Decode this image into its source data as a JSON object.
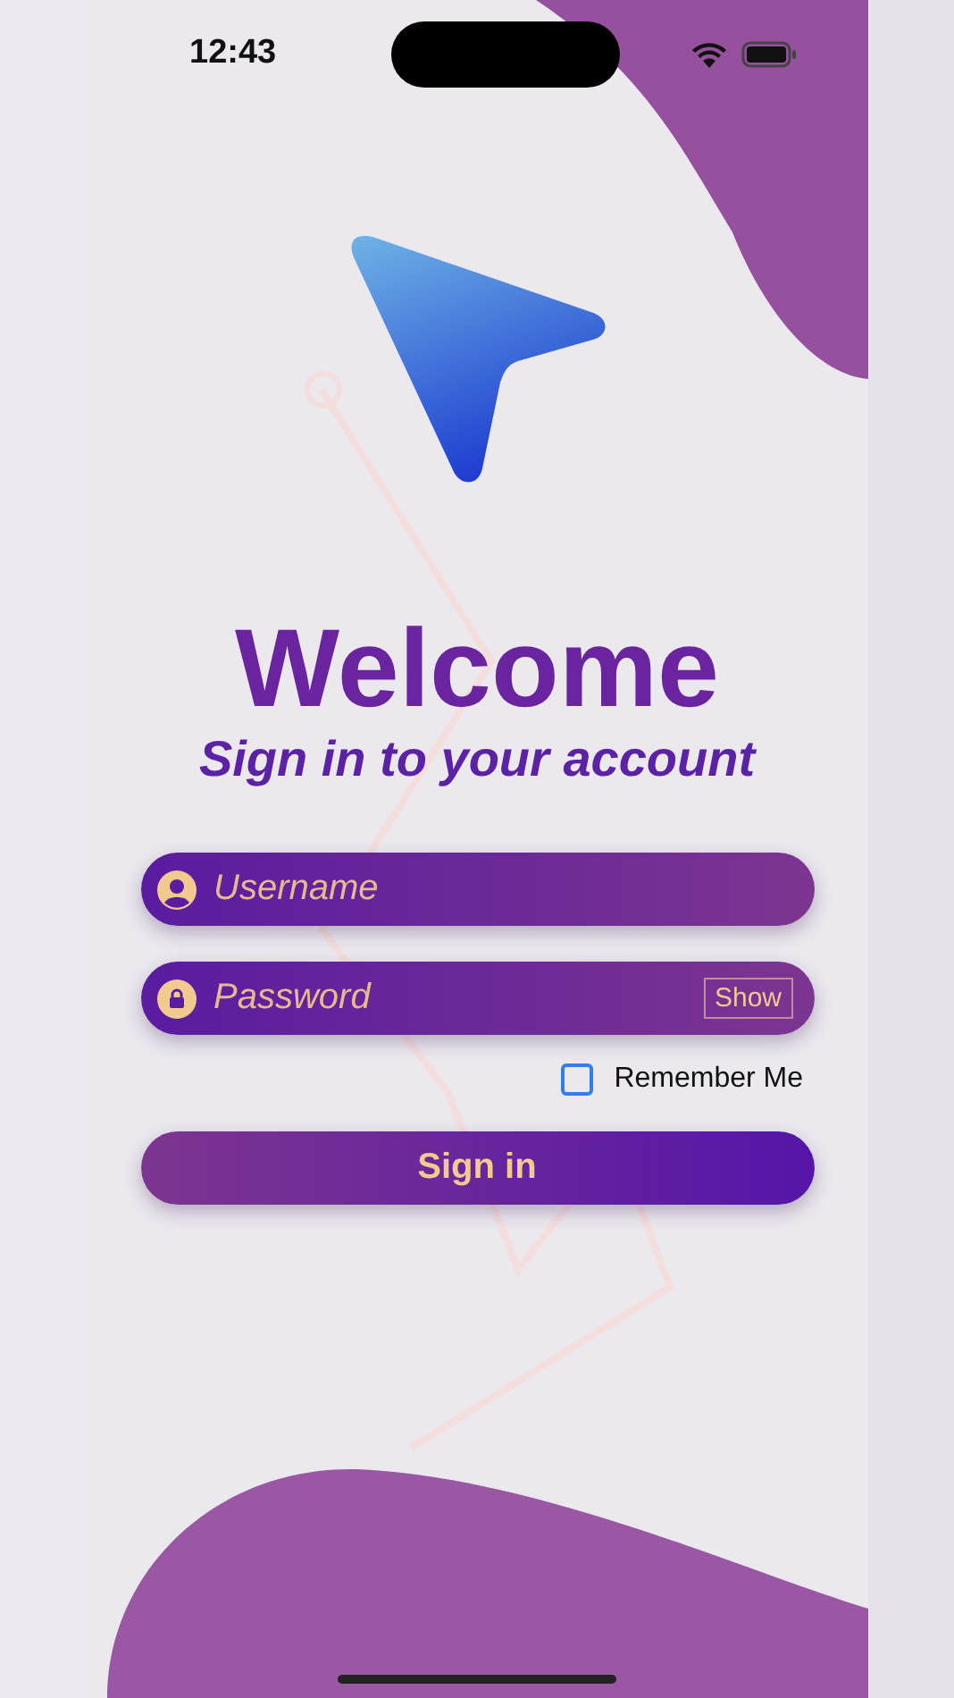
{
  "status_bar": {
    "time": "12:43"
  },
  "title": "Welcome",
  "subtitle": "Sign in to your account",
  "fields": [
    {
      "kind": "username",
      "placeholder": "Username"
    },
    {
      "kind": "password",
      "placeholder": "Password",
      "action": "Show"
    }
  ],
  "remember": {
    "label": "Remember Me",
    "checked": false
  },
  "button": "Sign in"
}
